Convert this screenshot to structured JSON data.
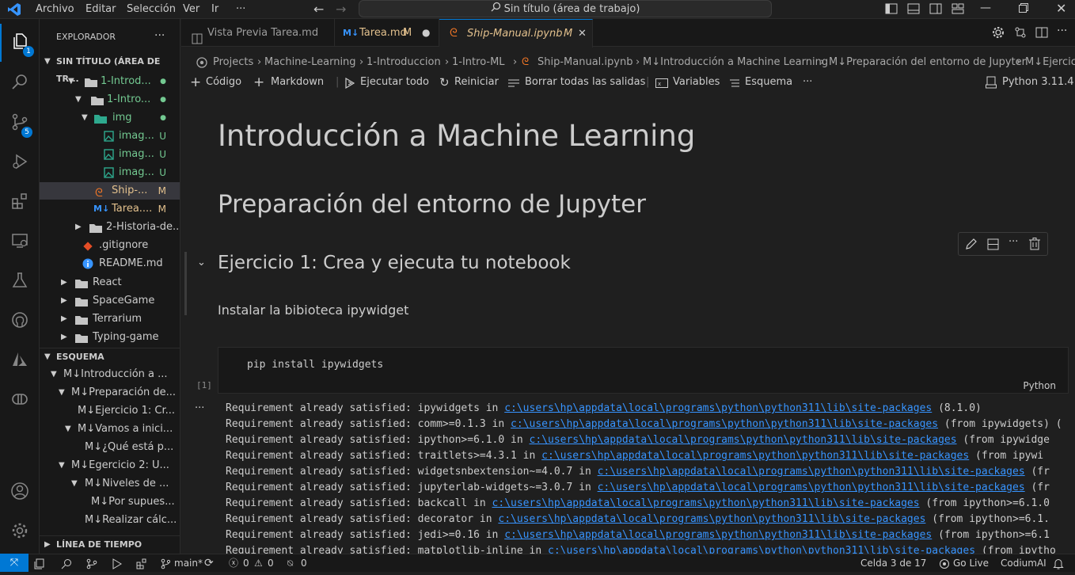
{
  "menu": {
    "items": [
      "Archivo",
      "Editar",
      "Selección",
      "Ver",
      "Ir",
      "···"
    ]
  },
  "command_center": {
    "text": "Sin título (área de trabajo)"
  },
  "activity": {
    "explorer_badge": "1",
    "scm_badge": "5"
  },
  "explorer": {
    "title": "EXPLORADOR",
    "more": "···",
    "workspace_title": "SIN TÍTULO (ÁREA DE TR...",
    "items": [
      {
        "label": "1-Introd...",
        "status": "●"
      },
      {
        "label": "1-Intro...",
        "status": "●"
      },
      {
        "label": "img",
        "status": "●"
      },
      {
        "label": "imag...",
        "status": "U"
      },
      {
        "label": "imag...",
        "status": "U"
      },
      {
        "label": "imag...",
        "status": "U"
      },
      {
        "label": "Ship-...",
        "status": "M"
      },
      {
        "label": "Tarea....",
        "status": "M"
      },
      {
        "label": "2-Historia-de...",
        "status": ""
      },
      {
        "label": ".gitignore",
        "status": ""
      },
      {
        "label": "README.md",
        "status": ""
      },
      {
        "label": "React",
        "status": ""
      },
      {
        "label": "SpaceGame",
        "status": ""
      },
      {
        "label": "Terrarium",
        "status": ""
      },
      {
        "label": "Typing-game",
        "status": ""
      }
    ]
  },
  "outline": {
    "title": "ESQUEMA",
    "items": [
      "M↓Introducción a ...",
      "M↓Preparación de...",
      "M↓Ejercicio 1: Cr...",
      "M↓Vamos a inici...",
      "M↓¿Qué está p...",
      "M↓Egercicio 2: U...",
      "M↓Niveles de ...",
      "M↓Por supues...",
      "M↓Realizar cálc..."
    ]
  },
  "timeline": {
    "title": "LÍNEA DE TIEMPO"
  },
  "tabs": [
    {
      "label": "Vista Previa Tarea.md",
      "status": ""
    },
    {
      "label": "Tarea.md",
      "status": "M"
    },
    {
      "label": "Ship-Manual.ipynb",
      "status": "M"
    }
  ],
  "breadcrumbs": [
    "Projects",
    "Machine-Learning",
    "1-Introduccion",
    "1-Intro-ML",
    "Ship-Manual.ipynb",
    "M↓Introducción a Machine Learning",
    "M↓Preparación del entorno de Jupyter",
    "M↓Ejercicio"
  ],
  "toolbar": {
    "code": "Código",
    "markdown": "Markdown",
    "run_all": "Ejecutar todo",
    "restart": "Reiniciar",
    "clear": "Borrar todas las salidas",
    "variables": "Variables",
    "outline": "Esquema",
    "more": "···",
    "kernel": "Python 3.11.4"
  },
  "notebook": {
    "h1": "Introducción a Machine Learning",
    "h2": "Preparación del entorno de Jupyter",
    "h3": "Ejercicio 1: Crea y ejecuta tu notebook",
    "para": "Instalar la bibioteca ipywidget",
    "code": "pip install ipywidgets",
    "exec_count": "[1]",
    "language": "Python",
    "output_more": "···",
    "outputs": [
      {
        "pre": "Requirement already satisfied: ipywidgets in ",
        "link": "c:\\users\\hp\\appdata\\local\\programs\\python\\python311\\lib\\site-packages",
        "post": " (8.1.0)"
      },
      {
        "pre": "Requirement already satisfied: comm>=0.1.3 in ",
        "link": "c:\\users\\hp\\appdata\\local\\programs\\python\\python311\\lib\\site-packages",
        "post": " (from ipywidgets) ("
      },
      {
        "pre": "Requirement already satisfied: ipython>=6.1.0 in ",
        "link": "c:\\users\\hp\\appdata\\local\\programs\\python\\python311\\lib\\site-packages",
        "post": " (from ipywidge"
      },
      {
        "pre": "Requirement already satisfied: traitlets>=4.3.1 in ",
        "link": "c:\\users\\hp\\appdata\\local\\programs\\python\\python311\\lib\\site-packages",
        "post": " (from ipywi"
      },
      {
        "pre": "Requirement already satisfied: widgetsnbextension~=4.0.7 in ",
        "link": "c:\\users\\hp\\appdata\\local\\programs\\python\\python311\\lib\\site-packages",
        "post": " (fr"
      },
      {
        "pre": "Requirement already satisfied: jupyterlab-widgets~=3.0.7 in ",
        "link": "c:\\users\\hp\\appdata\\local\\programs\\python\\python311\\lib\\site-packages",
        "post": " (fr"
      },
      {
        "pre": "Requirement already satisfied: backcall in ",
        "link": "c:\\users\\hp\\appdata\\local\\programs\\python\\python311\\lib\\site-packages",
        "post": " (from ipython>=6.1.0"
      },
      {
        "pre": "Requirement already satisfied: decorator in ",
        "link": "c:\\users\\hp\\appdata\\local\\programs\\python\\python311\\lib\\site-packages",
        "post": " (from ipython>=6.1."
      },
      {
        "pre": "Requirement already satisfied: jedi>=0.16 in ",
        "link": "c:\\users\\hp\\appdata\\local\\programs\\python\\python311\\lib\\site-packages",
        "post": " (from ipython>=6.1"
      },
      {
        "pre": "Requirement already satisfied: matplotlib-inline in ",
        "link": "c:\\users\\hp\\appdata\\local\\programs\\python\\python311\\lib\\site-packages",
        "post": " (from ipytho"
      }
    ]
  },
  "status": {
    "branch": "main*",
    "errors": "0",
    "warnings": "0",
    "ports": "0",
    "cell": "Celda 3 de 17",
    "golive": "Go Live",
    "codium": "CodiumAI"
  },
  "colors": {
    "accent": "#0078d4",
    "link": "#3794ff",
    "untracked": "#73c991",
    "modified": "#e2c08d"
  }
}
